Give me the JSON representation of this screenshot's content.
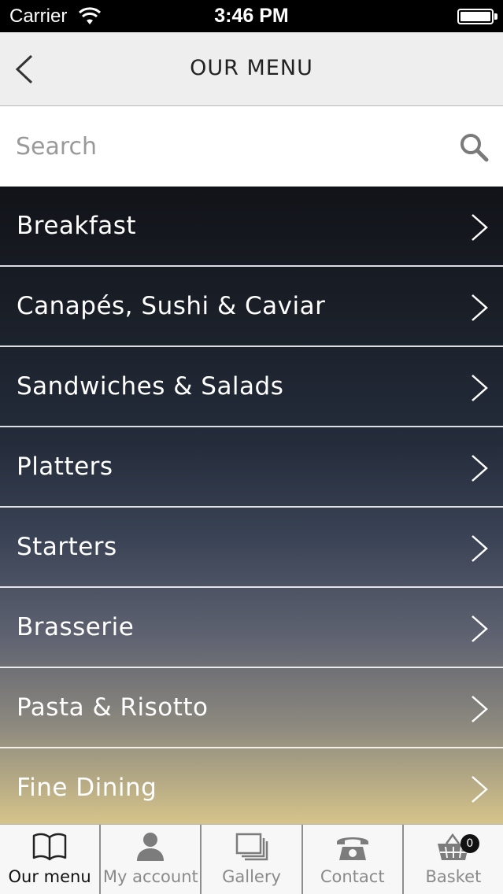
{
  "status_bar": {
    "carrier": "Carrier",
    "time": "3:46 PM"
  },
  "nav": {
    "title": "OUR MENU"
  },
  "search": {
    "placeholder": "Search"
  },
  "menu": {
    "items": [
      {
        "label": "Breakfast"
      },
      {
        "label": "Canapés, Sushi & Caviar"
      },
      {
        "label": "Sandwiches & Salads"
      },
      {
        "label": "Platters"
      },
      {
        "label": "Starters"
      },
      {
        "label": "Brasserie"
      },
      {
        "label": "Pasta & Risotto"
      },
      {
        "label": "Fine Dining"
      }
    ]
  },
  "tabs": [
    {
      "label": "Our menu",
      "icon": "book-icon",
      "active": true
    },
    {
      "label": "My account",
      "icon": "user-icon",
      "active": false
    },
    {
      "label": "Gallery",
      "icon": "gallery-icon",
      "active": false
    },
    {
      "label": "Contact",
      "icon": "phone-icon",
      "active": false
    },
    {
      "label": "Basket",
      "icon": "basket-icon",
      "active": false,
      "badge": "0"
    }
  ]
}
